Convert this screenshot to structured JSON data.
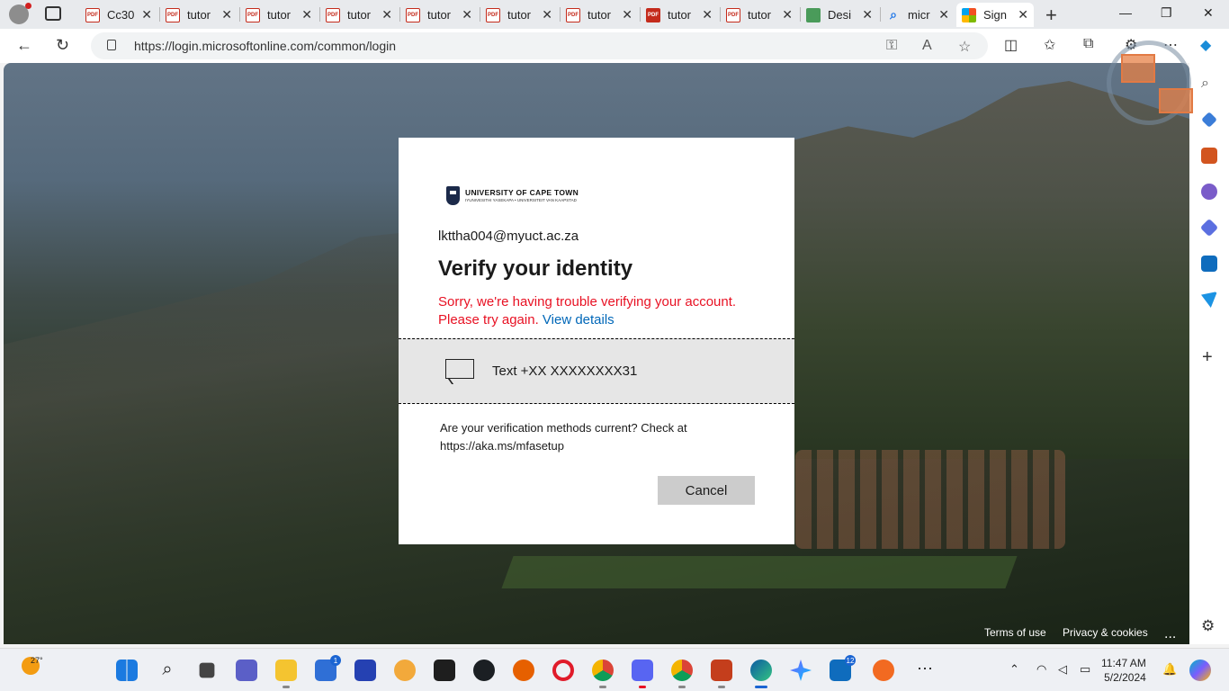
{
  "browser": {
    "tabs": [
      {
        "label": "Cc30",
        "icon": "pdf-icon"
      },
      {
        "label": "tutor",
        "icon": "pdf-icon"
      },
      {
        "label": "tutor",
        "icon": "pdf-icon"
      },
      {
        "label": "tutor",
        "icon": "pdf-icon"
      },
      {
        "label": "tutor",
        "icon": "pdf-icon"
      },
      {
        "label": "tutor",
        "icon": "pdf-icon"
      },
      {
        "label": "tutor",
        "icon": "pdf-icon"
      },
      {
        "label": "tutor",
        "icon": "pdf-icon"
      },
      {
        "label": "tutor",
        "icon": "pdf-icon"
      },
      {
        "label": "Desi",
        "icon": "design-icon"
      },
      {
        "label": "micr",
        "icon": "search-icon"
      },
      {
        "label": "Sign",
        "icon": "microsoft-icon",
        "active": true
      }
    ],
    "url": "https://login.microsoftonline.com/common/login"
  },
  "dialog": {
    "org_logo_text": "UNIVERSITY OF CAPE TOWN",
    "org_logo_subtext": "IYUNIVESITHI YASEKAPA • UNIVERSITEIT VAN KAAPSTAD",
    "email": "lkttha004@myuct.ac.za",
    "title": "Verify your identity",
    "error_text": "Sorry, we're having trouble verifying your account. Please try again.",
    "error_link": "View details",
    "method_label": "Text +XX XXXXXXXX31",
    "note": "Are your verification methods current? Check at https://aka.ms/mfasetup",
    "cancel_label": "Cancel"
  },
  "footer": {
    "terms": "Terms of use",
    "privacy": "Privacy & cookies",
    "more": "..."
  },
  "taskbar": {
    "temperature": "27°",
    "time": "11:47 AM",
    "date": "5/2/2024",
    "badges": {
      "store": "1",
      "mail": "12"
    }
  },
  "colors": {
    "error": "#e81123",
    "link": "#0067b8",
    "method_bg": "#e6e6e6",
    "button_bg": "#cccccc"
  }
}
